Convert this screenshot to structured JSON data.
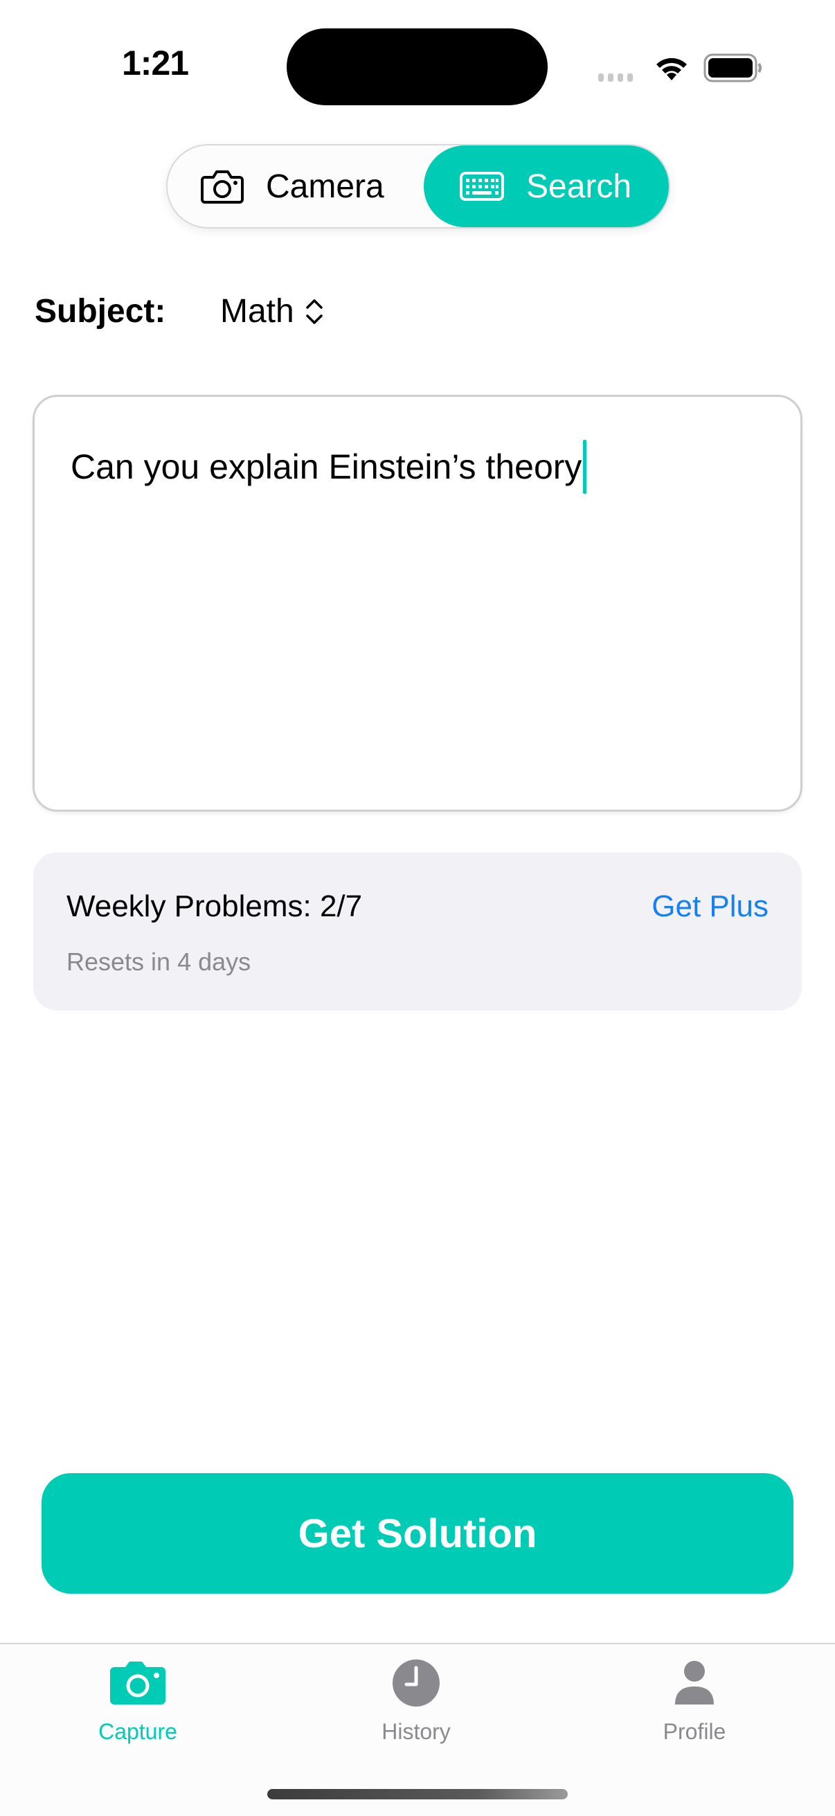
{
  "status_bar": {
    "time": "1:21",
    "icons": [
      "cellular-signal-icon",
      "wifi-icon",
      "battery-icon"
    ]
  },
  "mode_switch": {
    "options": [
      {
        "label": "Camera",
        "icon": "camera-icon",
        "selected": false
      },
      {
        "label": "Search",
        "icon": "keyboard-icon",
        "selected": true
      }
    ]
  },
  "subject": {
    "label": "Subject:",
    "value": "Math",
    "icon": "chevron-up-down-icon"
  },
  "query": {
    "value": "Can you explain Einstein’s theory"
  },
  "usage": {
    "title": "Weekly Problems: 2/7",
    "used": 2,
    "limit": 7,
    "subtitle": "Resets in 4 days",
    "upgrade_link": "Get Plus"
  },
  "primary_action": {
    "label": "Get Solution"
  },
  "tab_bar": {
    "items": [
      {
        "label": "Capture",
        "icon": "camera-fill-icon",
        "active": true
      },
      {
        "label": "History",
        "icon": "clock-fill-icon",
        "active": false
      },
      {
        "label": "Profile",
        "icon": "person-fill-icon",
        "active": false
      }
    ]
  },
  "colors": {
    "accent": "#00cbb5",
    "link": "#1580ee",
    "secondary_text": "#8a8a8e",
    "card_background": "#f1f1f6",
    "inactive_tab": "#8a8a8e"
  }
}
